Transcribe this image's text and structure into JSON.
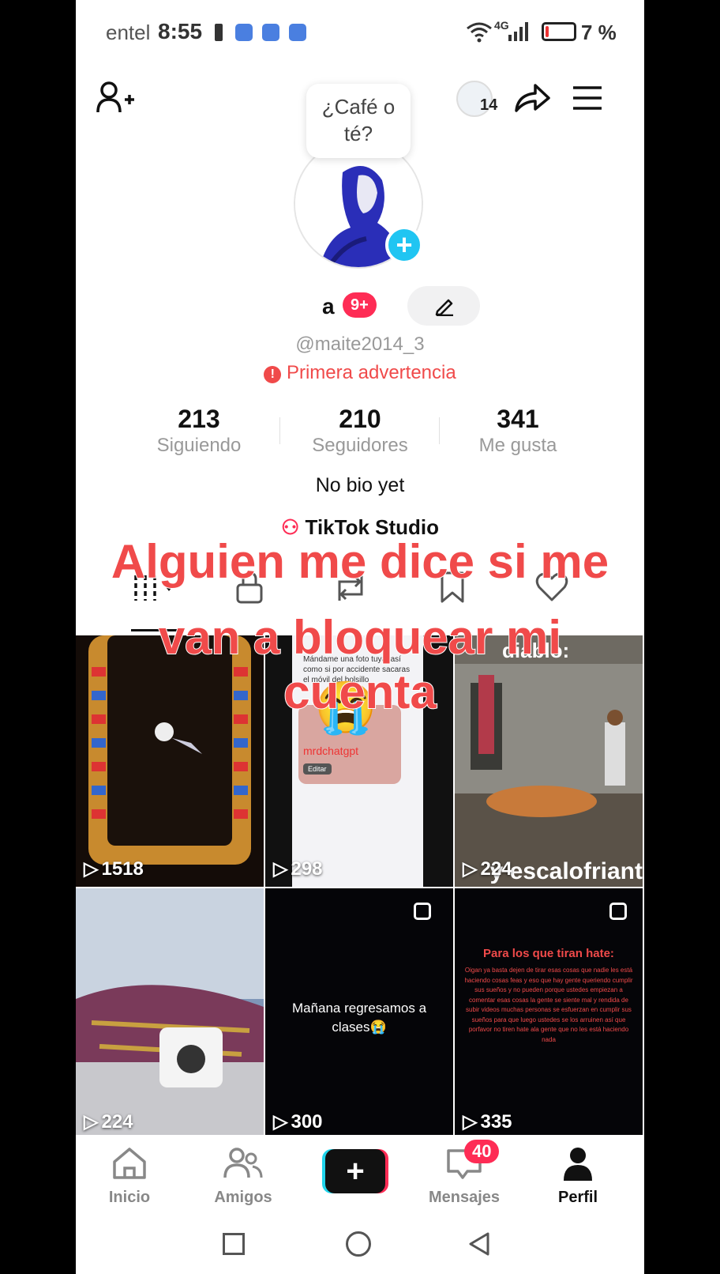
{
  "status_bar": {
    "carrier": "entel",
    "time": "8:55",
    "network": "4G",
    "battery": "7 %",
    "battery_level_percent": 7
  },
  "header": {
    "follower_badge_count": "14"
  },
  "profile": {
    "note_bubble": "¿Café o té?",
    "name": "a",
    "name_badge": "9+",
    "username": "@maite2014_3",
    "warning": "Primera advertencia",
    "stats": [
      {
        "value": "213",
        "label": "Siguiendo"
      },
      {
        "value": "210",
        "label": "Seguidores"
      },
      {
        "value": "341",
        "label": "Me gusta"
      }
    ],
    "bio": "No bio yet",
    "studio_link": "TikTok Studio"
  },
  "overlay_caption": {
    "line1": "Alguien me dice si me",
    "line2": "van a bloquear mi cuenta"
  },
  "videos": [
    {
      "views": "1518"
    },
    {
      "views": "298",
      "inner_text": "Mándame una foto tuya, así como si por accidente sacaras el móvil del bolsillo",
      "inner_label": "mrdchatgpt",
      "inner_button": "Editar"
    },
    {
      "views": "224",
      "top_text": "diablo:",
      "bottom_text": "y escalofriant"
    },
    {
      "views": "224"
    },
    {
      "views": "300",
      "text": "Mañana regresamos a clases😭"
    },
    {
      "views": "335",
      "title": "Para los que tiran hate:",
      "body": "Oigan ya basta dejen de tirar esas cosas que nadie les está haciendo cosas feas y eso que hay gente queriendo cumplir sus sueños y no pueden porque ustedes empiezan a comentar esas cosas la gente se siente mal y rendida de subir videos muchas personas se esfuerzan en cumplir sus sueños para que luego ustedes se los arruinen así que porfavor no tiren hate ala gente que no les está haciendo nada"
    }
  ],
  "bottom_nav": [
    {
      "label": "Inicio"
    },
    {
      "label": "Amigos"
    },
    {
      "label": ""
    },
    {
      "label": "Mensajes",
      "badge": "40"
    },
    {
      "label": "Perfil"
    }
  ],
  "colors": {
    "accent_red": "#fe2c55",
    "warning_red": "#f04a4a",
    "cyan": "#20c5f2"
  }
}
